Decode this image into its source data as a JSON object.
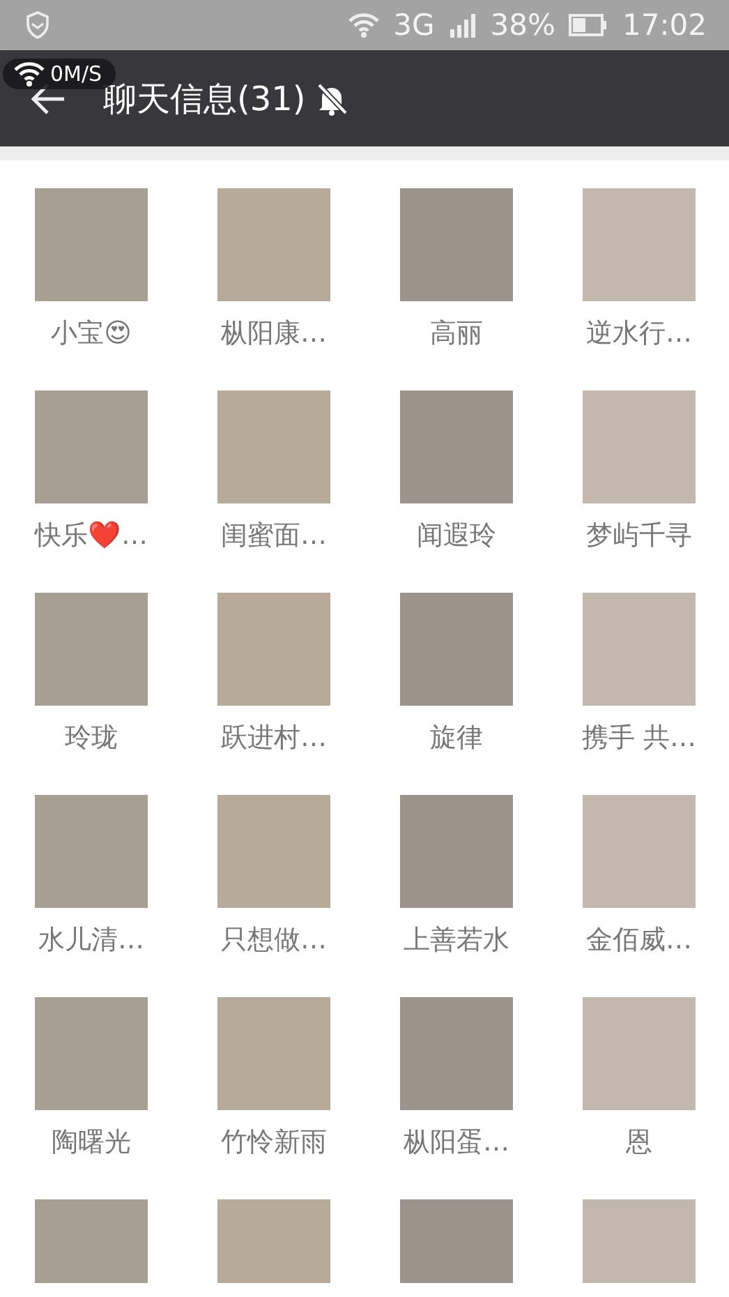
{
  "status_bar": {
    "network": "3G",
    "battery": "38%",
    "time": "17:02"
  },
  "speed_overlay": {
    "speed": "0M/S"
  },
  "title_bar": {
    "title": "聊天信息(31)",
    "muted": true
  },
  "members": [
    {
      "kind": "named",
      "name": "小宝😍"
    },
    {
      "kind": "named",
      "name": "枞阳康…"
    },
    {
      "kind": "named",
      "name": "高丽"
    },
    {
      "kind": "named",
      "name": "逆水行…"
    },
    {
      "kind": "named",
      "name": "快乐❤️…"
    },
    {
      "kind": "named",
      "name": "闺蜜面…"
    },
    {
      "kind": "named",
      "name": "闻遐玲"
    },
    {
      "kind": "named",
      "name": "梦屿千寻"
    },
    {
      "kind": "named",
      "name": "玲珑"
    },
    {
      "kind": "named",
      "name": "跃进村…"
    },
    {
      "kind": "named",
      "name": "旋律"
    },
    {
      "kind": "named",
      "name": "携手 共…"
    },
    {
      "kind": "named",
      "name": "水儿清…"
    },
    {
      "kind": "named",
      "name": "只想做…"
    },
    {
      "kind": "named",
      "name": "上善若水"
    },
    {
      "kind": "named",
      "name": "金佰威…"
    },
    {
      "kind": "named",
      "name": "陶曙光"
    },
    {
      "kind": "named",
      "name": "竹怜新雨"
    },
    {
      "kind": "named",
      "name": "枞阳蛋…"
    },
    {
      "kind": "named",
      "name": "恩"
    },
    {
      "kind": "avatar_only"
    },
    {
      "kind": "avatar_only"
    },
    {
      "kind": "avatar_only"
    },
    {
      "kind": "avatar_only"
    }
  ]
}
